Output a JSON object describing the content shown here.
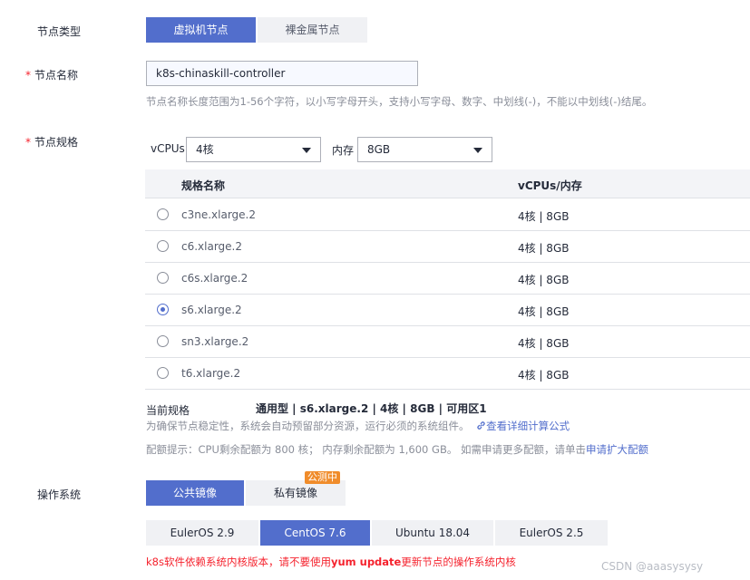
{
  "node_type": {
    "label": "节点类型",
    "options": [
      "虚拟机节点",
      "裸金属节点"
    ],
    "selected": "虚拟机节点"
  },
  "node_name": {
    "required_mark": "*",
    "label": "节点名称",
    "value": "k8s-chinaskill-controller",
    "hint": "节点名称长度范围为1-56个字符，以小写字母开头，支持小写字母、数字、中划线(-)，不能以中划线(-)结尾。"
  },
  "node_spec": {
    "required_mark": "*",
    "label": "节点规格",
    "vcpu_label": "vCPUs",
    "vcpu_value": "4核",
    "memory_label": "内存",
    "memory_value": "8GB",
    "columns": [
      "规格名称",
      "vCPUs/内存"
    ],
    "rows": [
      {
        "name": "c3ne.xlarge.2",
        "spec": "4核 | 8GB",
        "selected": false
      },
      {
        "name": "c6.xlarge.2",
        "spec": "4核 | 8GB",
        "selected": false
      },
      {
        "name": "c6s.xlarge.2",
        "spec": "4核 | 8GB",
        "selected": false
      },
      {
        "name": "s6.xlarge.2",
        "spec": "4核 | 8GB",
        "selected": true
      },
      {
        "name": "sn3.xlarge.2",
        "spec": "4核 | 8GB",
        "selected": false
      },
      {
        "name": "t6.xlarge.2",
        "spec": "4核 | 8GB",
        "selected": false
      }
    ],
    "current_label": "当前规格",
    "current_value": "通用型 | s6.xlarge.2 | 4核 | 8GB | 可用区1",
    "reserve_note": "为确保节点稳定性，系统会自动预留部分资源，运行必须的系统组件。",
    "formula_link": "查看详细计算公式",
    "quota_note": "配额提示：CPU剩余配额为 800 核； 内存剩余配额为 1,600 GB。 如需申请更多配额，请单击",
    "quota_link": "申请扩大配额"
  },
  "os": {
    "label": "操作系统",
    "image_tabs": [
      "公共镜像",
      "私有镜像"
    ],
    "selected_tab": "公共镜像",
    "beta_badge": "公测中",
    "versions": [
      "EulerOS 2.9",
      "CentOS 7.6",
      "Ubuntu 18.04",
      "EulerOS 2.5"
    ],
    "selected_version": "CentOS 7.6",
    "warning_prefix": "k8s软件依赖系统内核版本，请不要使用",
    "warning_cmd": "yum update",
    "warning_suffix": "更新节点的操作系统内核"
  },
  "watermark": "CSDN @aaasysysy",
  "colors": {
    "primary": "#526ecc",
    "danger": "#f5222d",
    "badge": "#f08c2b"
  }
}
